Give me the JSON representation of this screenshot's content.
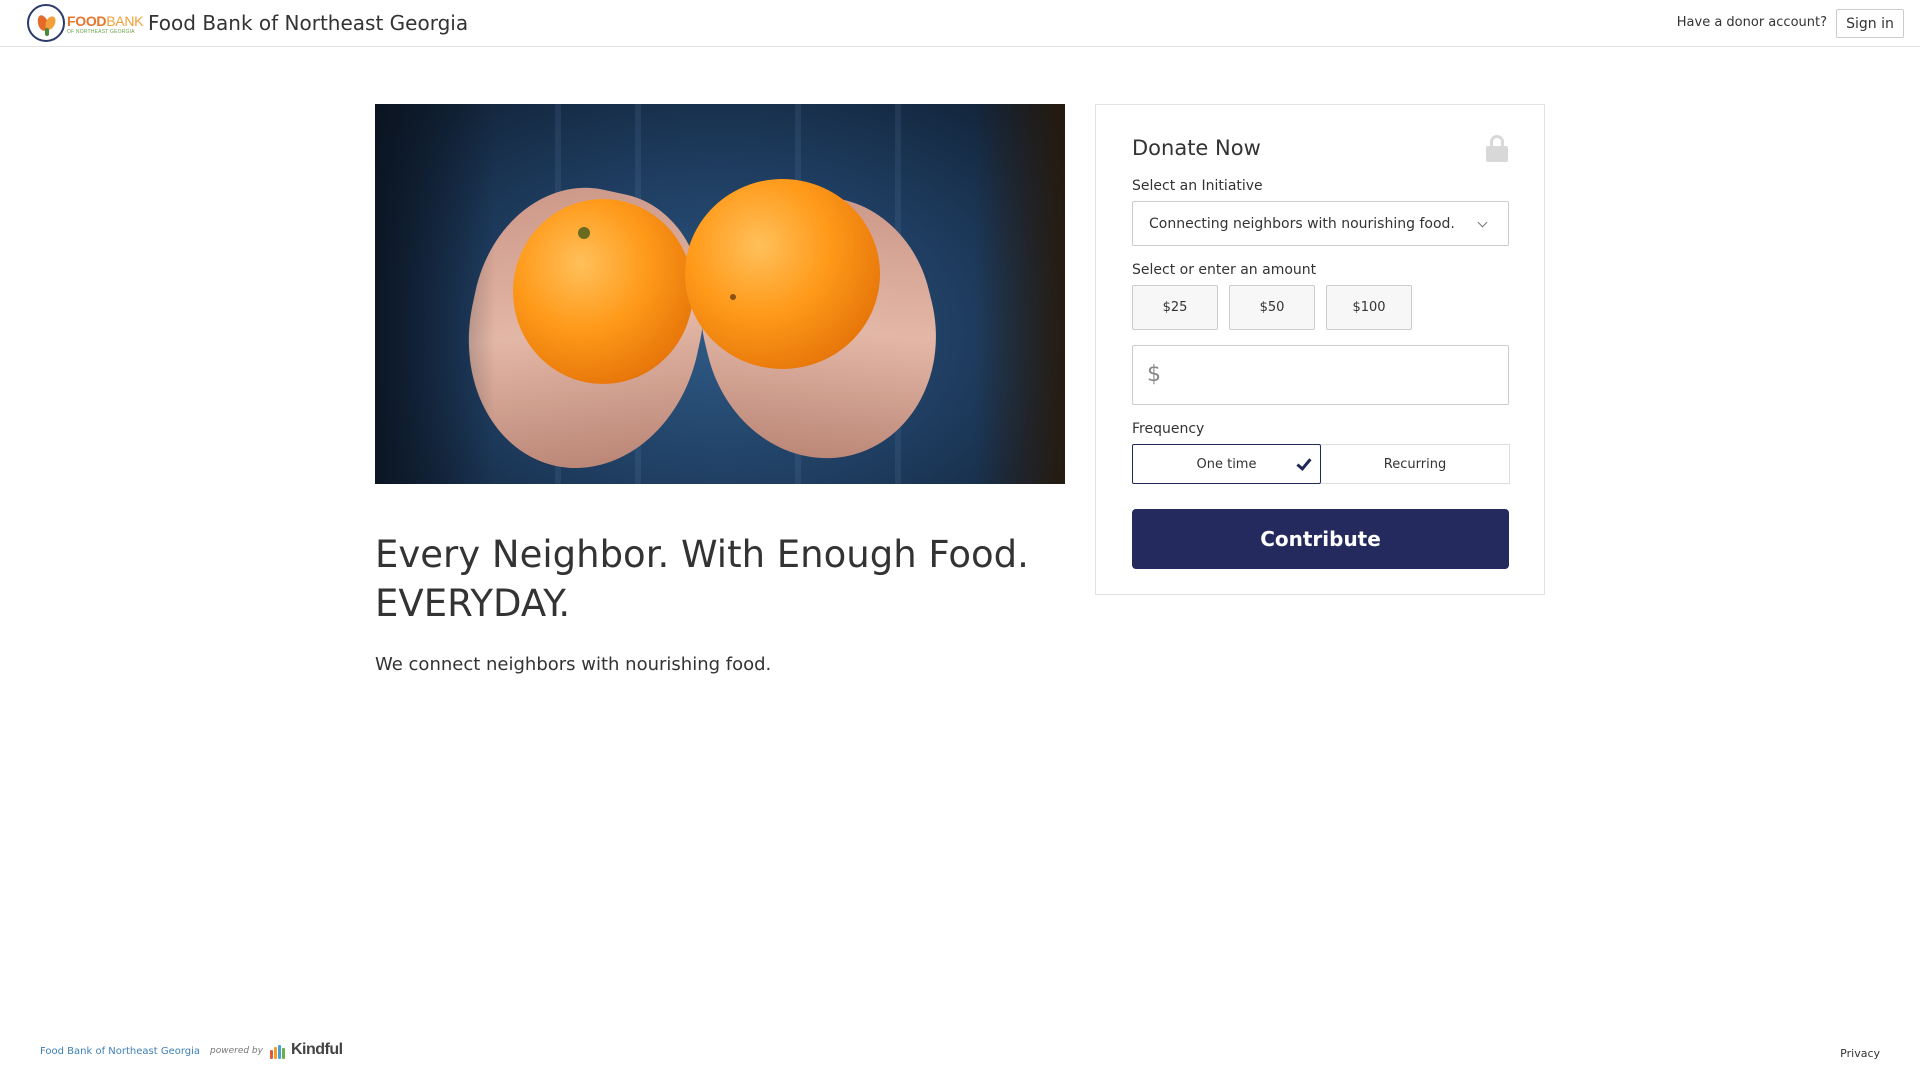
{
  "header": {
    "logo": {
      "word1": "FOOD",
      "word2": "BANK",
      "sub": "OF NORTHEAST GEORGIA"
    },
    "org_name": "Food Bank of Northeast Georgia",
    "donor_prompt": "Have a donor account?",
    "sign_in_label": "Sign in"
  },
  "hero": {
    "image_alt": "Hands holding two oranges",
    "headline": "Every Neighbor. With Enough Food. EVERYDAY.",
    "subline": "We connect neighbors with nourishing food."
  },
  "donate": {
    "title": "Donate Now",
    "initiative_label": "Select an Initiative",
    "initiative_value": "Connecting neighbors with nourishing food.",
    "amount_label": "Select or enter an amount",
    "amounts": [
      "$25",
      "$50",
      "$100"
    ],
    "currency_symbol": "$",
    "custom_amount_value": "",
    "frequency_label": "Frequency",
    "frequency_options": [
      "One time",
      "Recurring"
    ],
    "frequency_selected": "One time",
    "contribute_label": "Contribute"
  },
  "footer": {
    "org_link": "Food Bank of Northeast Georgia",
    "powered_by": "powered by",
    "brand": "Kindful",
    "privacy": "Privacy"
  },
  "colors": {
    "accent": "#242a5e",
    "link": "#3d7fb5",
    "logo_orange": "#e8742c"
  }
}
